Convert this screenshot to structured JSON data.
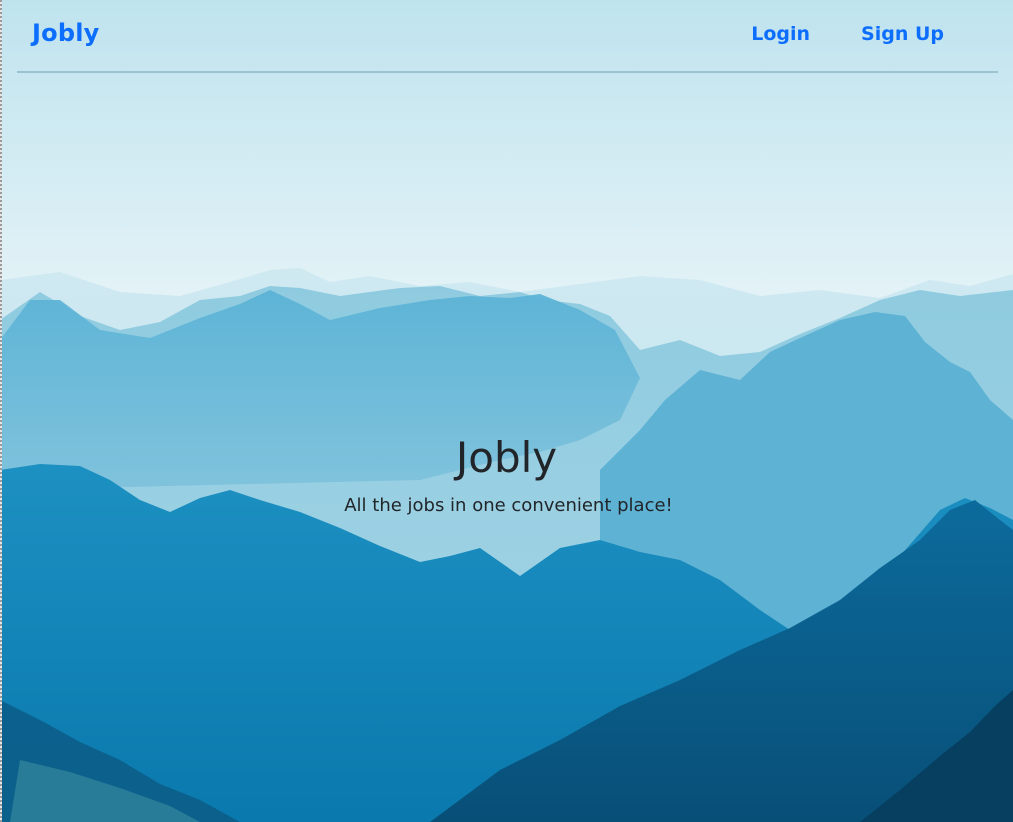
{
  "navbar": {
    "brand": "Jobly",
    "links": [
      {
        "label": "Login"
      },
      {
        "label": "Sign Up"
      }
    ]
  },
  "hero": {
    "title": "Jobly",
    "tagline": "All the jobs in one convenient place!"
  },
  "colors": {
    "link_blue": "#0d6efd",
    "text_dark": "#212529",
    "sky": "#c6e6ef",
    "mountain_dark": "#0a6596"
  }
}
